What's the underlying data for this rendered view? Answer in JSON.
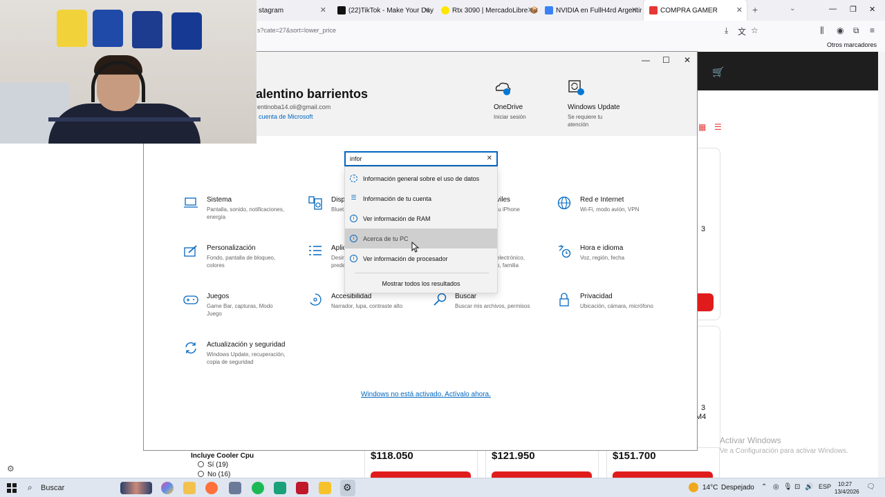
{
  "browser": {
    "tabs": [
      {
        "label": "stagram",
        "color": "#d62976"
      },
      {
        "label": "(22)TikTok - Make Your Day",
        "color": "#111111"
      },
      {
        "label": "Rtx 3090 | MercadoLibre 📦",
        "color": "#ffe600"
      },
      {
        "label": "NVIDIA en FullH4rd Argentina",
        "color": "#3b82f6"
      },
      {
        "label": "COMPRA GAMER",
        "color": "#e53935"
      }
    ],
    "url": "s?cate=27&sort=lower_price",
    "bookmarks_label": "Otros marcadores"
  },
  "store": {
    "filter_heading": "Incluye Cooler Cpu",
    "filter_options": [
      "Sí (19)",
      "No (16)"
    ],
    "prices": [
      "$118.050",
      "$121.950",
      "$151.700"
    ],
    "partial_text_1": "3",
    "partial_text_2": "3",
    "partial_text_3": "M4",
    "watermark_title": "Activar Windows",
    "watermark_sub": "Ve a Configuración para activar Windows."
  },
  "settings": {
    "window_controls": {
      "minimize": "—",
      "maximize": "☐",
      "close": "✕"
    },
    "user": {
      "name": "alentino barrientos",
      "email": "entinoba14.oli@gmail.com",
      "link": "cuenta de Microsoft"
    },
    "onedrive": {
      "title": "OneDrive",
      "sub": "Iniciar sesión"
    },
    "windows_update": {
      "title": "Windows Update",
      "sub1": "Se requiere tu",
      "sub2": "atención"
    },
    "search": {
      "value": "infor"
    },
    "results": [
      "Información general sobre el uso de datos",
      "Información de tu cuenta",
      "Ver información de RAM",
      "Acerca de tu PC",
      "Ver información de procesador"
    ],
    "show_all": "Mostrar todos los resultados",
    "categories": {
      "sistema": {
        "title": "Sistema",
        "sub1": "Pantalla, sonido, notificaciones,",
        "sub2": "energía"
      },
      "dispositivos": {
        "title": "Disp",
        "sub1": "Bluet"
      },
      "moviles": {
        "title": "viles",
        "sub1": "tu iPhone"
      },
      "red": {
        "title": "Red e Internet",
        "sub1": "Wi-Fi, modo avión, VPN"
      },
      "personalizacion": {
        "title": "Personalización",
        "sub1": "Fondo, pantalla de bloqueo,",
        "sub2": "colores"
      },
      "aplicaciones": {
        "title": "Aplic",
        "sub1": "Desin",
        "sub2": "prede"
      },
      "cuentas": {
        "sub1": "electrónico,",
        "sub2": "o, familia"
      },
      "hora": {
        "title": "Hora e idioma",
        "sub1": "Voz, región, fecha"
      },
      "juegos": {
        "title": "Juegos",
        "sub1": "Game Bar, capturas, Modo",
        "sub2": "Juego"
      },
      "accesibilidad": {
        "title": "Accesibilidad",
        "sub1": "Narrador, lupa, contraste alto"
      },
      "buscar": {
        "title": "Buscar",
        "sub1": "Buscar mis archivos, permisos"
      },
      "privacidad": {
        "title": "Privacidad",
        "sub1": "Ubicación, cámara, micrófono"
      },
      "actualizacion": {
        "title": "Actualización y seguridad",
        "sub1": "Windows Update, recuperación,",
        "sub2": "copia de seguridad"
      }
    },
    "activation_link": "Windows no está activado. Actívalo ahora."
  },
  "taskbar": {
    "search_label": "Buscar",
    "weather_temp": "14°C",
    "weather_desc": "Despejado",
    "language": "ESP",
    "time": "10:27",
    "date": "13/4/2026"
  },
  "colors": {
    "accent": "#0067c0",
    "store_red": "#e01b1b"
  }
}
